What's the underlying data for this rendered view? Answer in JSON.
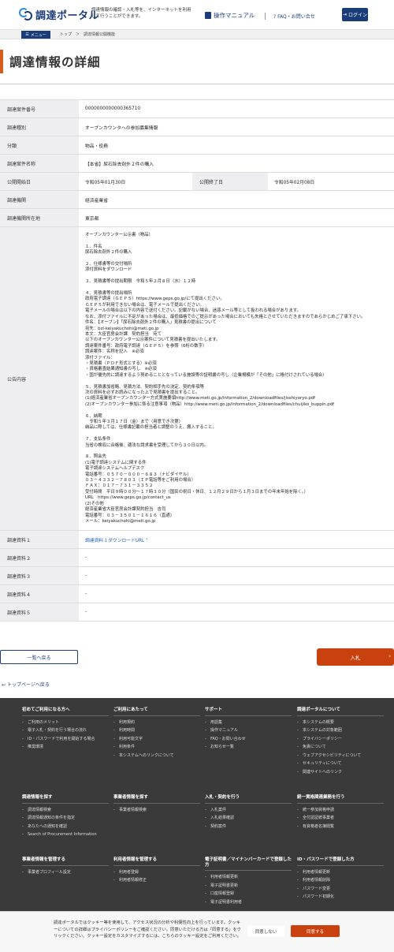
{
  "header": {
    "logo_text": "調達ポータル",
    "tagline": "調達情報の確認・入札等を、インターネットを利用して行うことができます。",
    "manual_label": "操作マニュアル",
    "faq_label": "FAQ・お問い合せ",
    "login_label": "ログイン"
  },
  "crumbbar": {
    "menu_label": "メニュー",
    "crumbs": "トップ　＞　調達情報公開機能"
  },
  "page_title": "調達情報の詳細",
  "detail": {
    "case_no_label": "調達案件番号",
    "case_no": "0000000000000365710",
    "type_label": "調達種別",
    "type": "オープンカウンタへの参加募集情報",
    "category_label": "分類",
    "category": "物品・役務",
    "name_label": "調達案件名称",
    "name": "【本省】尿石除去剤外２件の購入",
    "start_label": "公開開始日",
    "start": "令和05年01月30日",
    "end_label": "公開終了日",
    "end": "令和05年02月08日",
    "org_label": "調達機関",
    "org": "経済産業省",
    "location_label": "調達機関所在地",
    "location": "東京都",
    "notice_label": "公告内容",
    "notice": "オープンカウンター公示書（物品）\n\n１、件名\n尿石除去剤外２件の購入\n\n２、仕様書等の交付場所\n添付資料をダウンロード\n\n３、見積書等の提出期限　令和５年２月８日（水）１２時\n\n４、見積書等の提出場所\n政府電子調達（ＧＥＰＳ）https://www.geps.go.jp/にて提出ください。\nＧＥＰＳが利用できない場合は、電子メールで提出ください。\n電子メールの場合は以下の内容で送付ください。記載がない場合、迷惑メール等として扱われる場合があります。\nなお、添付ファイルに不足があった場合は、最低価格でのご提示があった場合においても失格とさせていただきますのであらかじめご了承下さい。\n件名：【オープン】「尿石除去剤外２件の購入」見積書の提出について\n宛先：bzl-keiyakuchohi@meti.go.jp\n本文：大臣官房会計課　契約担当　宛て\n以下のオープンカウンター公示案件について見積書を提出いたします。\n調達案件番号：政府電子調達（ＧＥＰＳ）を参照（6桁の数字）\n調達案件：名称を記入　※必須\n添付ファイル：\n・見積書（ＰＤＦ形式とする）※必須\n・資格審査結果通知書の写し　※必須\n・国が優先的に調達するよう努めることとなっている施設等の証明書の写し（企業規模が「その他」に格付けされている場合）\n\n５、見積書加省略、見積方法、契約相手先の決定、契約条項等\n次の資料を必ずお読みになった上で見積書を提出すること。\n(1)経済産業省オープンカウンター方式実施要領http://www.meti.go.jp/information_2/downloadfiles/jisshiyoryo.pdf\n(2)オープンカウンター参加に係る注意事項（物品）http://www.meti.go.jp/information_2/downloadfiles/chuijiko_buppin.pdf\n\n６、納期\n　令和５年３月１７日（金）まで（用意でき次第）\n納品に際しては、仕様書記載の担当者と調整のうえ、搬入すること。\n\n７、支払条件\n当省の検収に合格後、適法な請求書を受理してから３０日以内。\n\n８、照会先\n(1)電子調達システムに関する件\n電子調達システムヘルプデスク\n電話番号：０５７０－０００－６８３（ナビダイヤル）\n０３－４３３２－７８０３（ＩＰ電話等をご利用の場合）\nＦＡＸ：０１７－７３１－３３５２\n受付時間　平日９時００分～１７時３０分（国民の祝日・休日、１２月２９日から１月３日までの年末年始を除く。）\nURL　https://www.geps.go.jp/contact_us\n(2)その他\n経済産業省大臣官房会計課契約担当　吉司\n電話番号：０３－３５０１－１６１６（直通）\nメール：keiyakuchohi@meti.go.jp",
    "doc1_label": "調達資料１",
    "doc1": "調達資料１ダウンロードURL",
    "doc2_label": "調達資料２",
    "doc2": "-",
    "doc3_label": "調達資料３",
    "doc3": "-",
    "doc4_label": "調達資料４",
    "doc4": "-",
    "doc5_label": "調達資料５",
    "doc5": "-"
  },
  "actions": {
    "back_label": "一覧へ戻る",
    "bid_label": "入札"
  },
  "to_top": "トップページへ戻る",
  "footer": {
    "col1_title": "初めてご利用になる方へ",
    "col1_items": [
      "ご利用のメリット",
      "電子入札・契約を行う場合の流れ",
      "ID・パスワードで利用を開始する場合",
      "推奨環境"
    ],
    "col2_title": "ご利用にあたって",
    "col2_items": [
      "利用規約",
      "利用時間",
      "利用可能文字",
      "利用条件",
      "本システムへのリンクについて"
    ],
    "col3_title": "サポート",
    "col3_items": [
      "用語集",
      "操作マニュアル",
      "FAQ・お問い合わせ",
      "お知らせ一覧"
    ],
    "col4_title": "調達ポータルについて",
    "col4_items": [
      "本システムの概要",
      "本システムの対象範囲",
      "プライバシーポリシー",
      "免責について",
      "ウェブアクセシビリティについて",
      "セキュリティについて",
      "関連サイトへのリンク"
    ],
    "col5_title": "調達情報を探す",
    "col5_items": [
      "調達情報検索",
      "調達情報通知の条件を指定",
      "あなたへの通知を確認",
      "Search of Procurement Information"
    ],
    "col6_title": "事業者情報を探す",
    "col6_items": [
      "事業者情報検索"
    ],
    "col7_title": "入札・契約を行う",
    "col7_items": [
      "入札案件",
      "入札結果確認",
      "契約案件"
    ],
    "col8_title": "統一資格関連業務を行う",
    "col8_items": [
      "統一参加資格申請",
      "全付認証統事業者",
      "有資格者名簿閲覧"
    ],
    "col9_title": "事業者情報を管理する",
    "col9_items": [
      "事業者プロフィール設定"
    ],
    "col10_title": "利用者情報を管理する",
    "col10_items": [
      "利用者登録",
      "利用者情報修正"
    ],
    "col11_title": "電子証明書／マイナンバーカードで登録した方",
    "col11_items": [
      "利用者情報更新",
      "電子証明書更新",
      "口座情報登録",
      "電子証明書利用者"
    ],
    "col12_title": "ID・パスワードで登録した方",
    "col12_items": [
      "利用者情報更新",
      "利用者情報削除",
      "パスワード変更",
      "パスワード初期化"
    ]
  },
  "cookie": {
    "text": "調達ポータルではクッキー等を使用して、アクセス状況の分析や利便性向上を行っています。クッキーについての詳細はプライバシーポリシーをご確認ください。同意いただける方は「同意する」をクリックください。クッキー設定をカスタマイズするには、こちらのクッキー設定をご利用ください。",
    "decline": "同意しない",
    "accept": "同意する"
  }
}
